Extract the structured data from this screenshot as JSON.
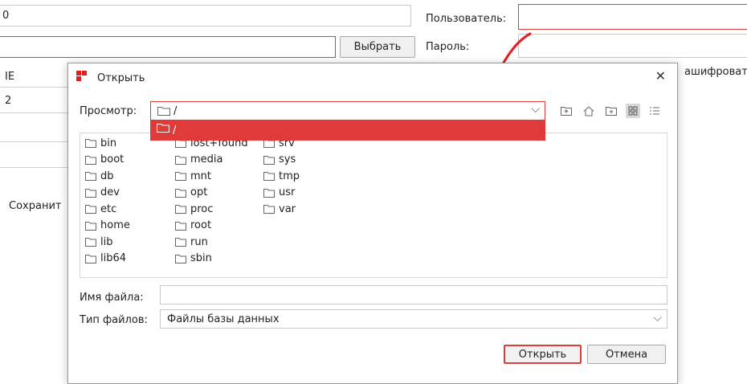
{
  "background": {
    "left_edge_values": [
      "0",
      "IE",
      "2"
    ],
    "select_button": "Выбрать",
    "user_label": "Пользователь:",
    "password_label": "Пароль:",
    "encrypt_fragment": "ашифровать",
    "save_fragment": "Сохранит"
  },
  "dialog": {
    "title": "Открыть",
    "close_glyph": "✕",
    "lookin_label": "Просмотр:",
    "lookin_value": "/",
    "dropdown_value": "/",
    "toolbar_icons": [
      "up-folder-icon",
      "home-icon",
      "new-folder-icon",
      "list-view-icon",
      "details-view-icon"
    ],
    "folders_col1": [
      "bin",
      "boot",
      "db",
      "dev",
      "etc",
      "home",
      "lib",
      "lib64"
    ],
    "folders_col2": [
      "lost+found",
      "media",
      "mnt",
      "opt",
      "proc",
      "root",
      "run",
      "sbin"
    ],
    "folders_col3": [
      "srv",
      "sys",
      "tmp",
      "usr",
      "var"
    ],
    "filename_label": "Имя файла:",
    "filename_value": "",
    "filetype_label": "Тип файлов:",
    "filetype_value": "Файлы базы данных",
    "open_button": "Открыть",
    "cancel_button": "Отмена"
  },
  "colors": {
    "accent_red": "#e03a3a",
    "field_red": "#d9403a"
  }
}
